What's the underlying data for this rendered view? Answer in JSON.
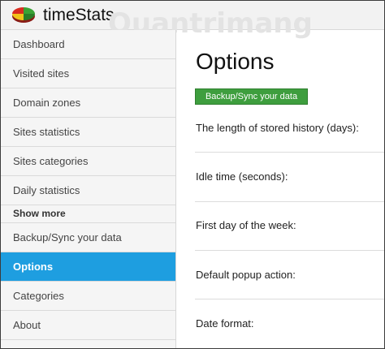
{
  "header": {
    "app_title": "timeStats",
    "watermark": "Quantrimang"
  },
  "sidebar": {
    "items": [
      {
        "label": "Dashboard"
      },
      {
        "label": "Visited sites"
      },
      {
        "label": "Domain zones"
      },
      {
        "label": "Sites statistics"
      },
      {
        "label": "Sites categories"
      },
      {
        "label": "Daily statistics"
      },
      {
        "label": "Show more"
      },
      {
        "label": "Backup/Sync your data"
      },
      {
        "label": "Options"
      },
      {
        "label": "Categories"
      },
      {
        "label": "About"
      }
    ],
    "active_index": 8
  },
  "main": {
    "title": "Options",
    "sync_button": "Backup/Sync your data",
    "options": [
      {
        "label": "The length of stored history (days):"
      },
      {
        "label": "Idle time (seconds):"
      },
      {
        "label": "First day of the week:"
      },
      {
        "label": "Default popup action:"
      },
      {
        "label": "Date format:"
      }
    ]
  },
  "colors": {
    "active_nav": "#1e9ee0",
    "sync_button": "#3e9e3e",
    "logo_red": "#d92b1f",
    "logo_green": "#3aa335",
    "logo_yellow": "#f2c318"
  }
}
